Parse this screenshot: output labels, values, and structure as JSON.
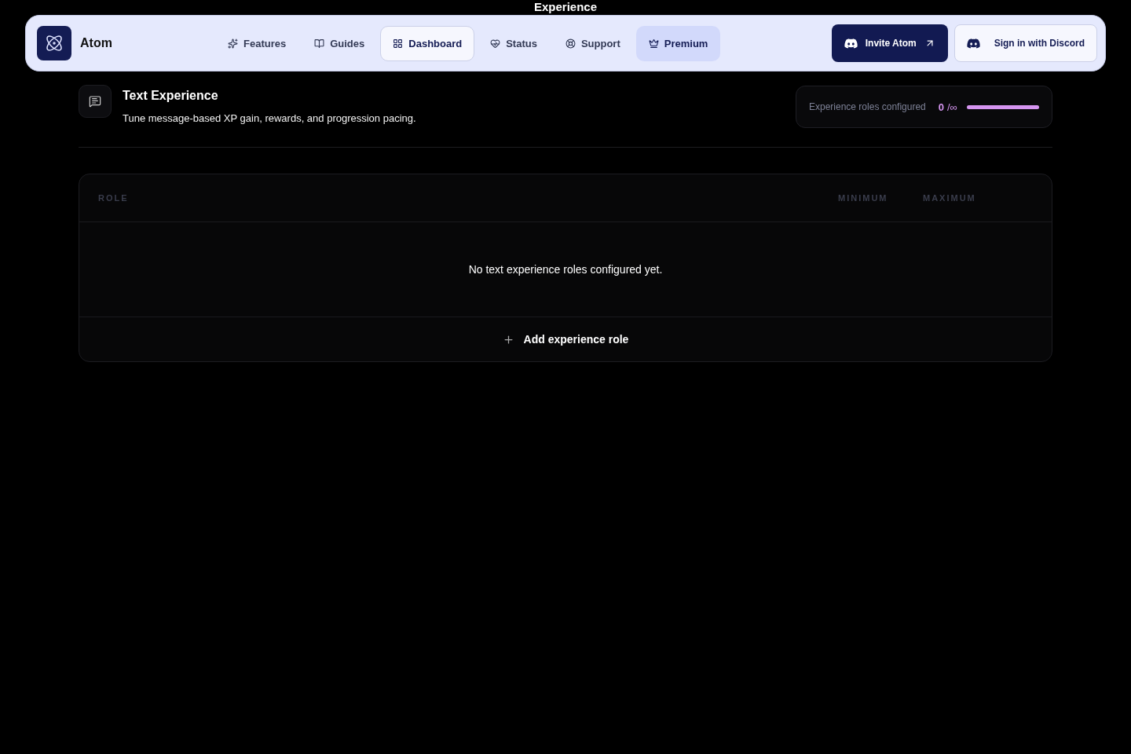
{
  "page_heading": "Experience",
  "nav": {
    "brand": "Atom",
    "links": [
      {
        "label": "Features",
        "selected": false,
        "highlighted": false
      },
      {
        "label": "Guides",
        "selected": false,
        "highlighted": false
      },
      {
        "label": "Dashboard",
        "selected": true,
        "highlighted": false
      },
      {
        "label": "Status",
        "selected": false,
        "highlighted": false
      },
      {
        "label": "Support",
        "selected": false,
        "highlighted": false
      },
      {
        "label": "Premium",
        "selected": false,
        "highlighted": true
      }
    ],
    "invite_button": "Invite Atom",
    "signin_button": "Sign in with Discord"
  },
  "section": {
    "title": "Text Experience",
    "description": "Tune message-based XP gain, rewards, and progression pacing.",
    "meter": {
      "label": "Experience roles configured",
      "count": "0",
      "limit": "/∞",
      "level": 1
    }
  },
  "table": {
    "columns": [
      "ROLE",
      "MINIMUM",
      "MAXIMUM"
    ],
    "empty_message": "No text experience roles configured yet.",
    "add_button": "Add experience role"
  }
}
